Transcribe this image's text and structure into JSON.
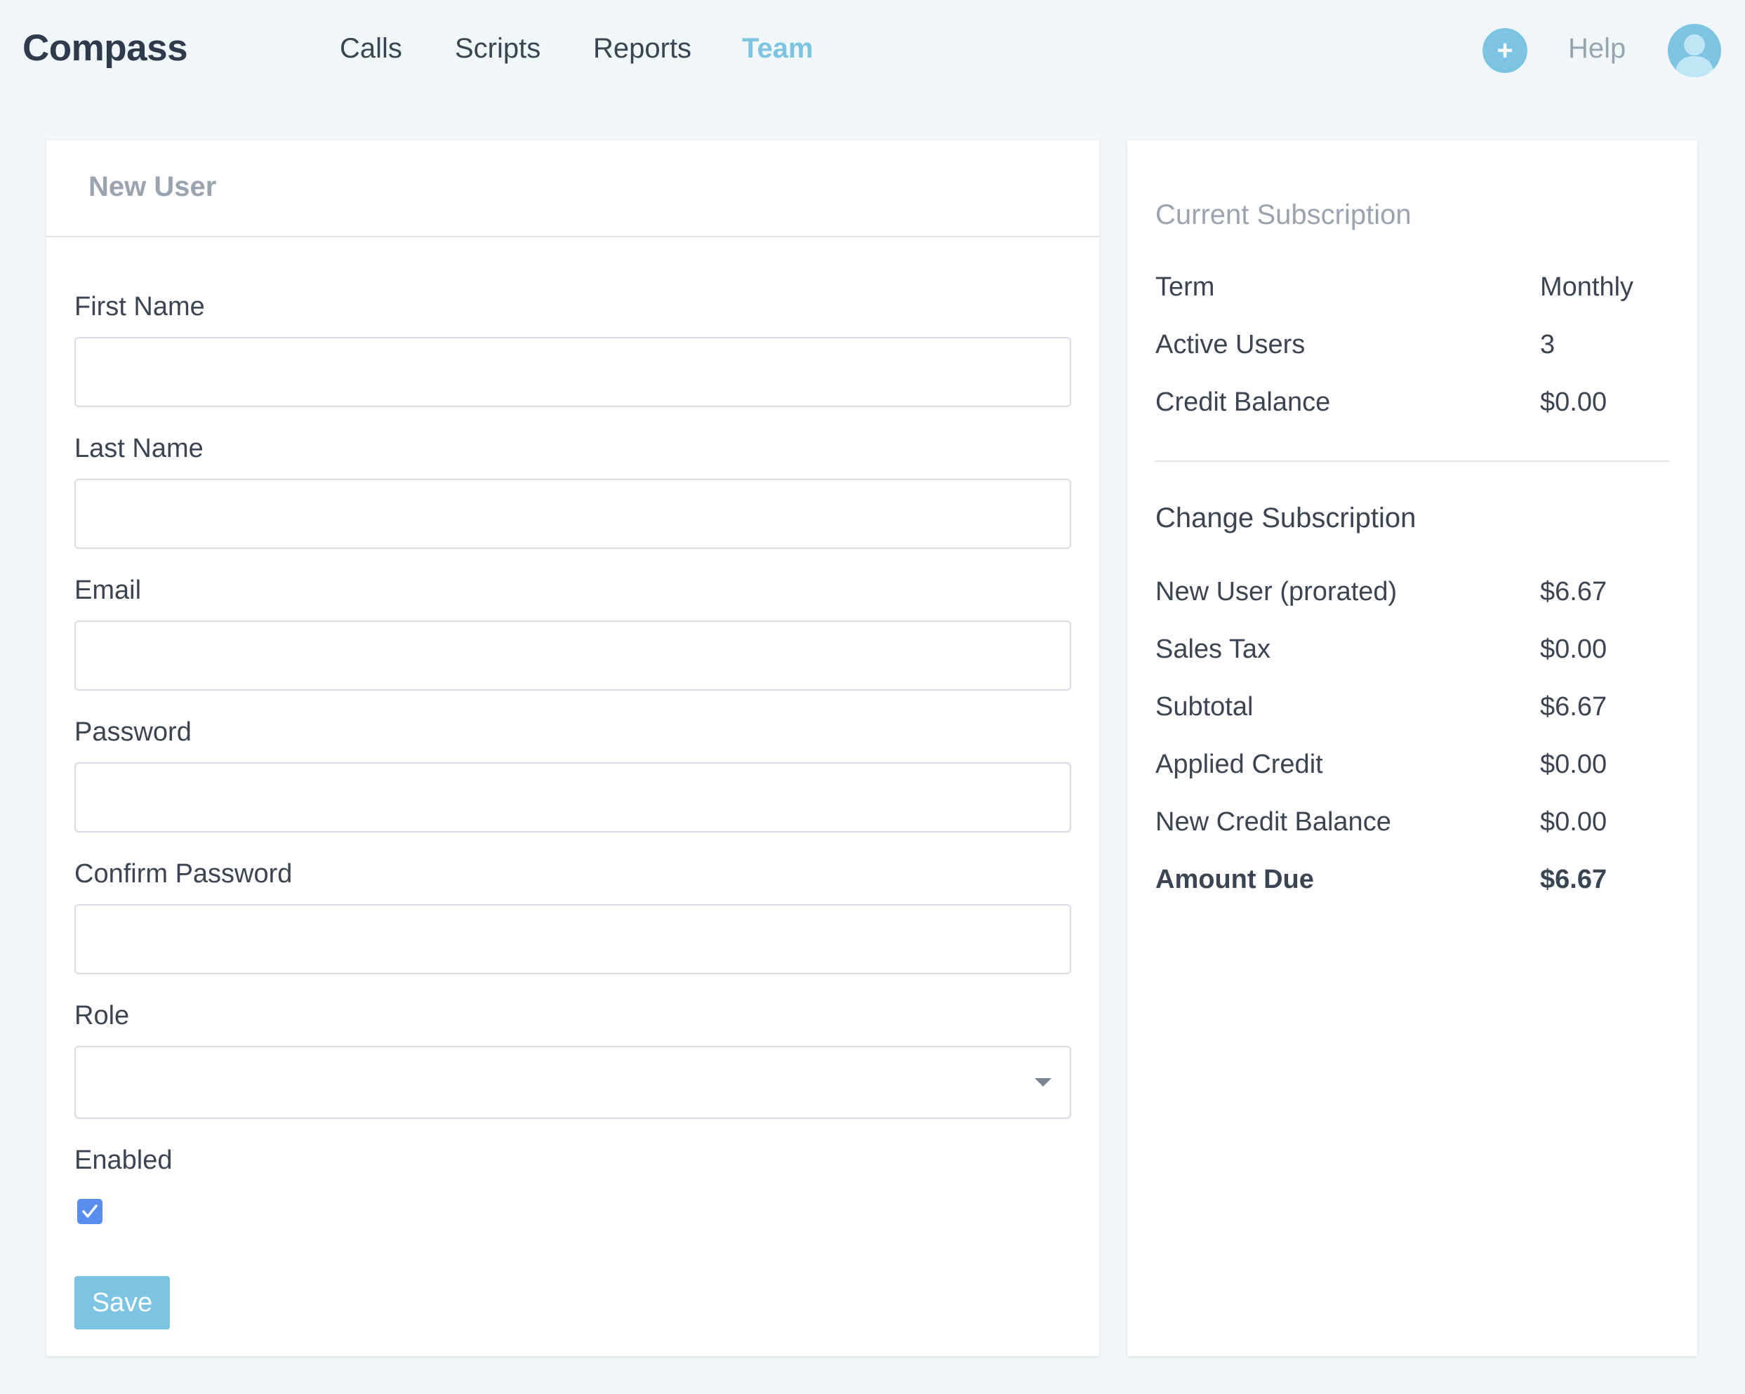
{
  "brand": "Compass",
  "nav": {
    "calls": "Calls",
    "scripts": "Scripts",
    "reports": "Reports",
    "team": "Team",
    "add": "+",
    "help": "Help"
  },
  "form": {
    "title": "New User",
    "first_name_label": "First Name",
    "first_name_value": "",
    "last_name_label": "Last Name",
    "last_name_value": "",
    "email_label": "Email",
    "email_value": "",
    "password_label": "Password",
    "password_value": "",
    "confirm_password_label": "Confirm Password",
    "confirm_password_value": "",
    "role_label": "Role",
    "role_value": "",
    "enabled_label": "Enabled",
    "enabled_checked": true,
    "save_label": "Save"
  },
  "subscription": {
    "current_title": "Current Subscription",
    "current_rows": [
      {
        "label": "Term",
        "value": "Monthly"
      },
      {
        "label": "Active Users",
        "value": "3"
      },
      {
        "label": "Credit Balance",
        "value": "$0.00"
      }
    ],
    "change_title": "Change Subscription",
    "change_rows": [
      {
        "label": "New User (prorated)",
        "value": "$6.67"
      },
      {
        "label": "Sales Tax",
        "value": "$0.00"
      },
      {
        "label": "Subtotal",
        "value": "$6.67"
      },
      {
        "label": "Applied Credit",
        "value": "$0.00"
      },
      {
        "label": "New Credit Balance",
        "value": "$0.00"
      },
      {
        "label": "Amount Due",
        "value": "$6.67"
      }
    ]
  },
  "colors": {
    "accent": "#7dc3e2",
    "checkbox": "#5b8def",
    "background": "#f1f6f9"
  },
  "icons": {
    "add": "plus-icon",
    "avatar": "user-avatar-icon",
    "select": "chevron-down-icon",
    "checkbox": "checkmark-icon"
  }
}
